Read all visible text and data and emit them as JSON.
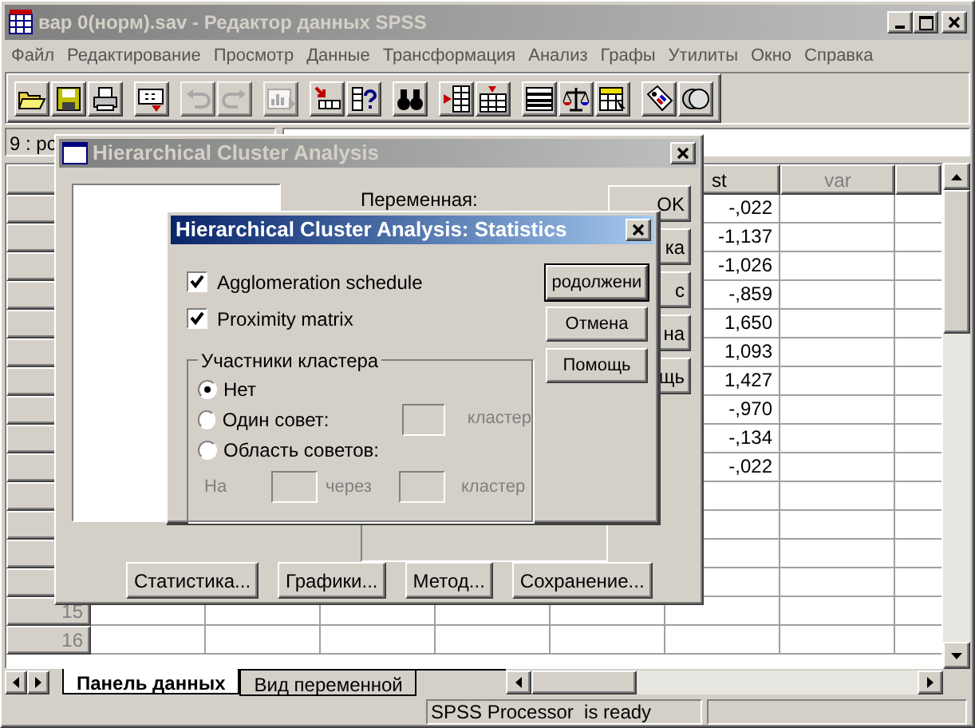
{
  "window": {
    "title": "вар 0(норм).sav - Редактор данных SPSS"
  },
  "menu": [
    "Файл",
    "Редактирование",
    "Просмотр",
    "Данные",
    "Трансформация",
    "Анализ",
    "Графы",
    "Утилиты",
    "Окно",
    "Справка"
  ],
  "toolbar": [
    {
      "kind": "open",
      "disabled": false
    },
    {
      "kind": "save",
      "disabled": false
    },
    {
      "kind": "print",
      "disabled": false
    },
    {
      "kind": "dialog",
      "disabled": false
    },
    {
      "kind": "undo",
      "disabled": true
    },
    {
      "kind": "redo",
      "disabled": true
    },
    {
      "kind": "chart",
      "disabled": true
    },
    {
      "kind": "goto",
      "disabled": false
    },
    {
      "kind": "varinfo",
      "disabled": false
    },
    {
      "kind": "find",
      "disabled": false
    },
    {
      "kind": "insertcase",
      "disabled": false
    },
    {
      "kind": "insertvar",
      "disabled": false
    },
    {
      "kind": "split",
      "disabled": false
    },
    {
      "kind": "weight",
      "disabled": false
    },
    {
      "kind": "select",
      "disabled": false
    },
    {
      "kind": "labels",
      "disabled": false
    },
    {
      "kind": "sets",
      "disabled": false
    }
  ],
  "cell_editor": {
    "cell_ref": "9 : рс"
  },
  "grid": {
    "columns": [
      {
        "label": "st",
        "used": true
      },
      {
        "label": "var",
        "used": false
      }
    ],
    "rows": [
      {
        "st": "-,022"
      },
      {
        "st": "-1,137"
      },
      {
        "st": "-1,026"
      },
      {
        "st": "-,859"
      },
      {
        "st": "1,650"
      },
      {
        "st": "1,093"
      },
      {
        "st": "1,427"
      },
      {
        "st": "-,970"
      },
      {
        "st": "-,134"
      },
      {
        "st": "-,022"
      },
      {},
      {},
      {},
      {},
      {
        "number": "15"
      },
      {
        "number": "16"
      }
    ]
  },
  "tabs": [
    {
      "label": "Панель данных",
      "selected": true
    },
    {
      "label": "Вид переменной",
      "selected": false
    }
  ],
  "status_bar": "SPSS Processor  is ready",
  "cluster_dialog": {
    "title": "Hierarchical Cluster Analysis",
    "variable_label": "Переменная:",
    "side_buttons": [
      "OK",
      "ка",
      "с",
      "на",
      "щь"
    ],
    "bottom_buttons": [
      "Статистика...",
      "Графики...",
      "Метод...",
      "Сохранение..."
    ]
  },
  "statistics_dialog": {
    "title": "Hierarchical Cluster Analysis: Statistics",
    "checkboxes": [
      {
        "label": "Agglomeration schedule",
        "checked": true
      },
      {
        "label": "Proximity matrix",
        "checked": true
      }
    ],
    "group": {
      "legend": "Участники кластера",
      "radios": [
        {
          "label": "Нет",
          "selected": true
        },
        {
          "label": "Один совет:",
          "selected": false
        },
        {
          "label": "Область советов:",
          "selected": false
        }
      ],
      "single_suffix": {
        "label": "кластер",
        "disabled": true
      },
      "range": {
        "from": "На",
        "through": "через",
        "suffix": "кластер",
        "disabled": true
      }
    },
    "buttons": [
      {
        "label": "родолжени",
        "default": true
      },
      {
        "label": "Отмена",
        "default": false
      },
      {
        "label": "Помощь",
        "default": false
      }
    ]
  }
}
